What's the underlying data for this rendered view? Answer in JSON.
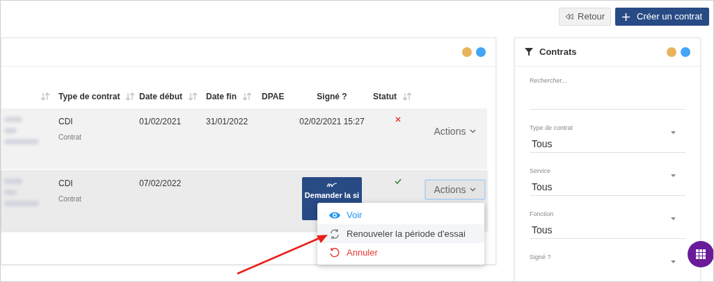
{
  "toolbar": {
    "back_button": "Retour",
    "create_button": "Créer un contrat"
  },
  "main_card": {
    "dots": [
      {
        "color": "#e8b35c"
      },
      {
        "color": "#42a5f5"
      }
    ],
    "table": {
      "columns": [
        {
          "sortable": true
        },
        {
          "label": "Type de contrat",
          "sortable": true
        },
        {
          "label": "Date début",
          "sortable": true
        },
        {
          "label": "Date fin",
          "sortable": true
        },
        {
          "label": "DPAE",
          "sortable": false
        },
        {
          "label": "Signé ?",
          "sortable": false
        },
        {
          "label": "Statut",
          "sortable": true
        }
      ],
      "rows": [
        {
          "type": "CDI",
          "subtype": "Contrat",
          "start": "01/02/2021",
          "end": "31/01/2022",
          "signed": {
            "kind": "date",
            "text": "02/02/2021 15:27"
          },
          "approved": false,
          "actions": "Actions",
          "actions_open": false
        },
        {
          "type": "CDI",
          "subtype": "Contrat",
          "start": "07/02/2022",
          "signed": {
            "kind": "button",
            "text": "Demander la si"
          },
          "approved": true,
          "actions": "Actions",
          "actions_open": true
        }
      ]
    },
    "menu": [
      {
        "kind": "view",
        "label": "Voir",
        "selected": false
      },
      {
        "kind": "renew",
        "label": "Renouveler la période d'essai",
        "selected": true
      },
      {
        "kind": "cancel",
        "label": "Annuler",
        "selected": false
      }
    ]
  },
  "filter_panel": {
    "title": "Contrats",
    "dots": [
      {
        "color": "#e8b35c"
      },
      {
        "color": "#42a5f5"
      }
    ],
    "search": {
      "placeholder": "Rechercher..."
    },
    "selects": [
      {
        "label": "Type de contrat",
        "value": "Tous"
      },
      {
        "label": "Service",
        "value": "Tous"
      },
      {
        "label": "Fonction",
        "value": "Tous"
      },
      {
        "label": "Signé ?"
      }
    ]
  }
}
